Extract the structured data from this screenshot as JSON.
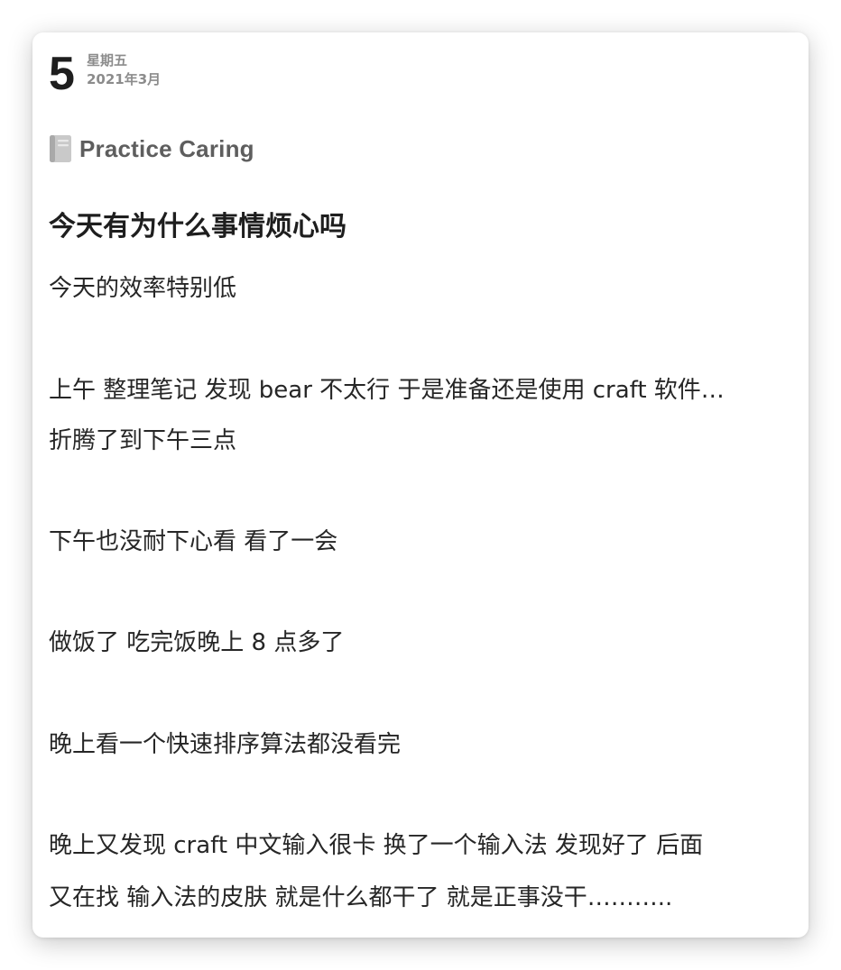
{
  "entry": {
    "day": "5",
    "weekday": "星期五",
    "month": "2021年3月",
    "journal_title": "Practice Caring",
    "journal_icon": "notebook-icon",
    "question": "今天有为什么事情烦心吗",
    "lines": [
      "今天的效率特别低",
      "上午 整理笔记  发现 bear 不太行  于是准备还是使用 craft 软件…",
      "折腾了到下午三点",
      "下午也没耐下心看  看了一会",
      "做饭了  吃完饭晚上 8 点多了",
      "晚上看一个快速排序算法都没看完",
      "晚上又发现 craft 中文输入很卡  换了一个输入法 发现好了  后面",
      "又在找 输入法的皮肤  就是什么都干了  就是正事没干……….."
    ]
  },
  "colors": {
    "primary_text": "#1e1e1e",
    "muted_text": "#8c8c8c",
    "journal_title": "#5e5e5e",
    "card_background": "#ffffff"
  }
}
